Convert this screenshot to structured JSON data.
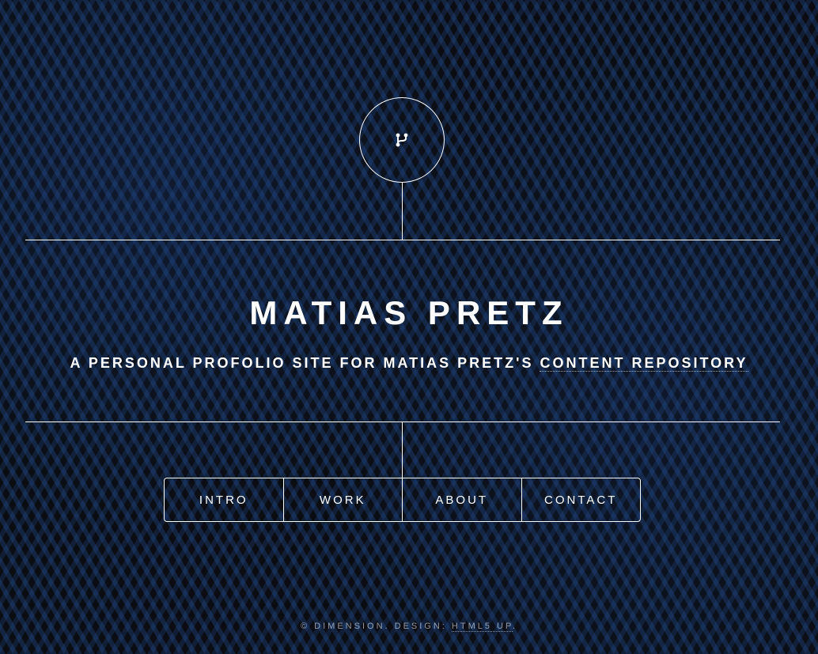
{
  "header": {
    "logo_icon": "code-fork-icon",
    "title": "MATIAS PRETZ",
    "subtitle_text": "A personal profolio site for Matias Pretz's ",
    "subtitle_link": "content repository"
  },
  "nav": {
    "items": [
      {
        "label": "INTRO"
      },
      {
        "label": "WORK"
      },
      {
        "label": "ABOUT"
      },
      {
        "label": "CONTACT"
      }
    ]
  },
  "footer": {
    "text": "© Dimension. Design: ",
    "link": "HTML5 UP",
    "suffix": "."
  },
  "colors": {
    "foreground": "#ffffff",
    "background": "#0b0d12",
    "hex_pattern": "#234f96"
  }
}
